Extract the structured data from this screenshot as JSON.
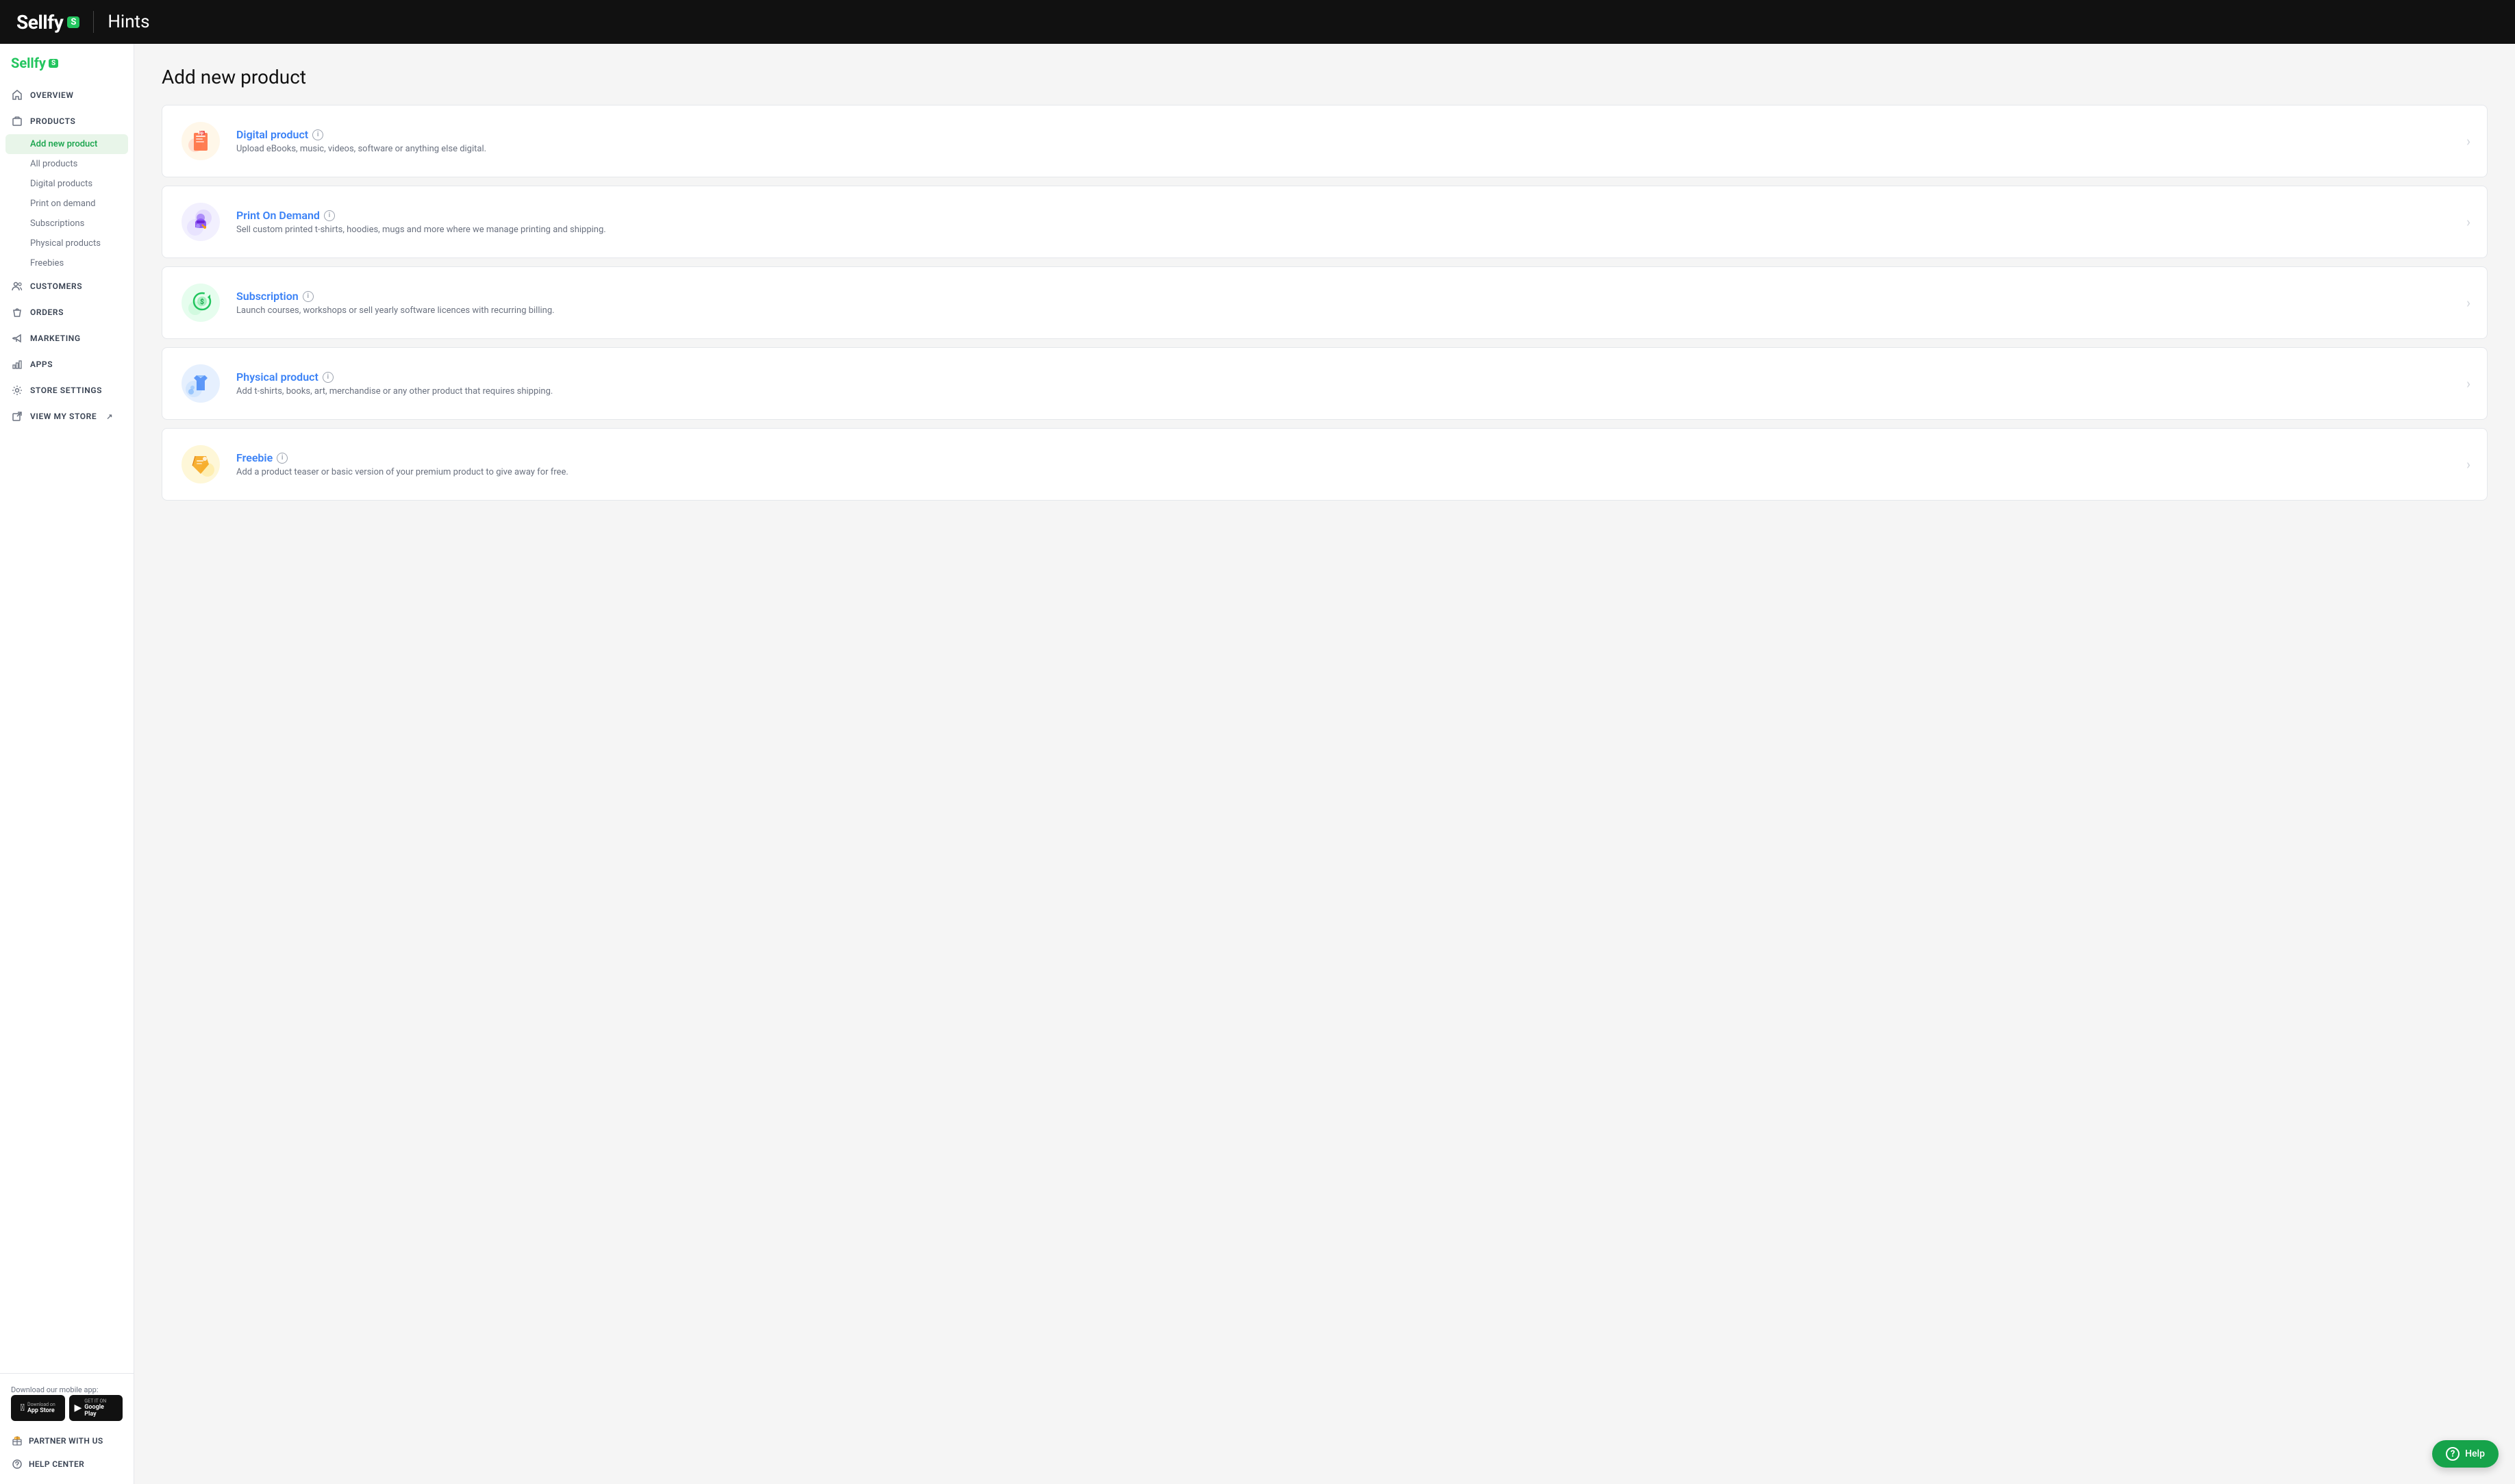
{
  "header": {
    "title": "Hints",
    "logo": "Sellfy",
    "badge": "S"
  },
  "sidebar": {
    "logo": "Sellfy",
    "badge": "S",
    "nav_items": [
      {
        "id": "overview",
        "label": "OVERVIEW",
        "icon": "home"
      },
      {
        "id": "products",
        "label": "PRODUCTS",
        "icon": "box",
        "active": true
      },
      {
        "id": "customers",
        "label": "CUSTOMERS",
        "icon": "users"
      },
      {
        "id": "orders",
        "label": "ORDERS",
        "icon": "shopping-bag"
      },
      {
        "id": "marketing",
        "label": "MARKETING",
        "icon": "megaphone"
      },
      {
        "id": "apps",
        "label": "APPS",
        "icon": "bar-chart"
      },
      {
        "id": "store-settings",
        "label": "STORE SETTINGS",
        "icon": "settings"
      },
      {
        "id": "view-my-store",
        "label": "VIEW MY STORE",
        "icon": "external-link"
      }
    ],
    "sub_nav": [
      {
        "id": "add-new-product",
        "label": "Add new product",
        "active": true
      },
      {
        "id": "all-products",
        "label": "All products"
      },
      {
        "id": "digital-products",
        "label": "Digital products"
      },
      {
        "id": "print-on-demand",
        "label": "Print on demand"
      },
      {
        "id": "subscriptions",
        "label": "Subscriptions"
      },
      {
        "id": "physical-products",
        "label": "Physical products"
      },
      {
        "id": "freebies",
        "label": "Freebies"
      }
    ],
    "footer_items": [
      {
        "id": "partner",
        "label": "PARTNER WITH US",
        "icon": "gift"
      },
      {
        "id": "help-center",
        "label": "HELP CENTER",
        "icon": "settings"
      }
    ],
    "mobile_app": {
      "label": "Download our mobile app:",
      "app_store": "Download on App Store",
      "google_play": "GET IT ON Google Play"
    }
  },
  "page": {
    "title": "Add new product",
    "products": [
      {
        "id": "digital",
        "title": "Digital product",
        "description": "Upload eBooks, music, videos, software or anything else digital.",
        "color": "#f97316"
      },
      {
        "id": "print-on-demand",
        "title": "Print On Demand",
        "description": "Sell custom printed t-shirts, hoodies, mugs and more where we manage printing and shipping.",
        "color": "#8b5cf6"
      },
      {
        "id": "subscription",
        "title": "Subscription",
        "description": "Launch courses, workshops or sell yearly software licences with recurring billing.",
        "color": "#22c55e"
      },
      {
        "id": "physical",
        "title": "Physical product",
        "description": "Add t-shirts, books, art, merchandise or any other product that requires shipping.",
        "color": "#3b82f6"
      },
      {
        "id": "freebie",
        "title": "Freebie",
        "description": "Add a product teaser or basic version of your premium product to give away for free.",
        "color": "#f59e0b"
      }
    ]
  },
  "help": {
    "label": "Help"
  }
}
